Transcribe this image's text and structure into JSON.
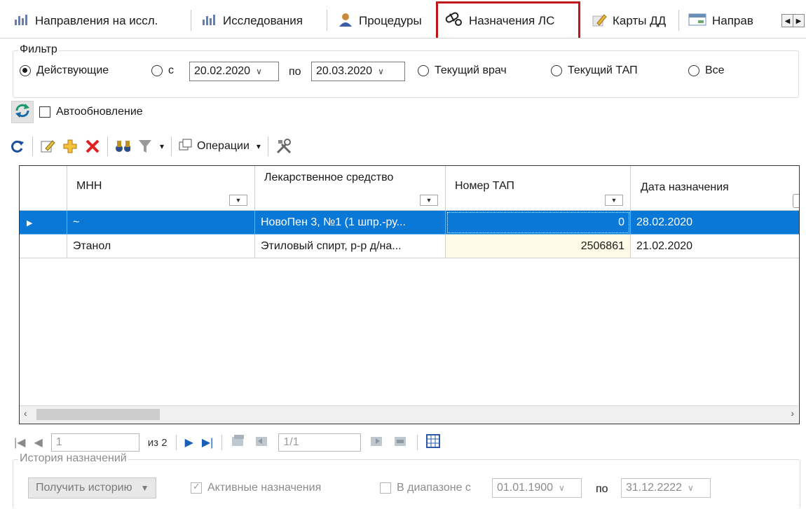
{
  "tabs": [
    {
      "label": "Направления на иссл.",
      "icon": "chart-icon"
    },
    {
      "label": "Исследования",
      "icon": "chart-icon"
    },
    {
      "label": "Процедуры",
      "icon": "person-icon"
    },
    {
      "label": "Назначения ЛС",
      "icon": "pills-icon",
      "active": true
    },
    {
      "label": "Карты ДД",
      "icon": "pencil-icon"
    },
    {
      "label": "Направ",
      "icon": "calendar-icon"
    }
  ],
  "filter": {
    "title": "Фильтр",
    "active_label": "Действующие",
    "from_label": "с",
    "from_date": "20.02.2020",
    "to_label": "по",
    "to_date": "20.03.2020",
    "current_doctor_label": "Текущий врач",
    "current_tap_label": "Текущий ТАП",
    "all_label": "Все"
  },
  "refresh": {
    "autoupdate_label": "Автообновление"
  },
  "toolbar": {
    "operations_label": "Операции"
  },
  "grid": {
    "columns": [
      {
        "label": "МНН"
      },
      {
        "label": "Лекарственное средство"
      },
      {
        "label": "Номер ТАП"
      },
      {
        "label": "Дата назначения"
      }
    ],
    "rows": [
      {
        "mnn": "~",
        "drug": "НовоПен 3, №1 (1 шпр.-ру...",
        "tap": "0",
        "date": "28.02.2020",
        "selected": true
      },
      {
        "mnn": "Этанол",
        "drug": "Этиловый спирт, р-р д/на...",
        "tap": "2506861",
        "date": "21.02.2020",
        "selected": false
      }
    ]
  },
  "navigator": {
    "page": "1",
    "of_label": "из 2",
    "position": "1/1"
  },
  "history": {
    "title": "История назначений",
    "get_history_label": "Получить историю",
    "active_label": "Активные назначения",
    "range_label": "В диапазоне с",
    "range_from": "01.01.1900",
    "range_to_label": "по",
    "range_to": "31.12.2222"
  }
}
